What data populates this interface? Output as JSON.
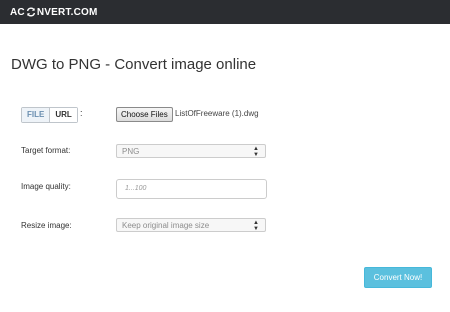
{
  "brand": {
    "logo_left": "AC",
    "logo_right": "NVERT.COM"
  },
  "page": {
    "title": "DWG to PNG - Convert image online"
  },
  "source": {
    "tab_file": "FILE",
    "tab_url": "URL",
    "colon": ":"
  },
  "upload": {
    "button_label": "Choose Files",
    "filename": "ListOfFreeware (1).dwg"
  },
  "form": {
    "target_format_label": "Target format:",
    "target_format_value": "PNG",
    "image_quality_label": "Image quality:",
    "image_quality_placeholder": "1...100",
    "resize_label": "Resize image:",
    "resize_value": "Keep original image size"
  },
  "actions": {
    "convert_label": "Convert Now!"
  },
  "colors": {
    "topbar": "#2b2d31",
    "accent": "#5bc0de"
  },
  "icons": {
    "logo_icon": "sync-arrows-icon",
    "select_arrows": "up-down-arrows-icon"
  }
}
